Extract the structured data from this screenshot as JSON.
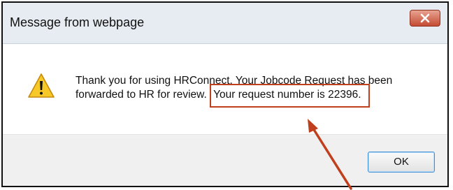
{
  "dialog": {
    "title": "Message from webpage",
    "close_label": "X",
    "message_part1": "Thank you for using HRConnect. Your Jobcode Request has been forwarded to HR for review.",
    "message_highlight": "Your request number is 22396.",
    "ok_label": "OK",
    "icon": "warning-icon"
  },
  "colors": {
    "annotation": "#c0401d",
    "title_bar": "#e7ecf3",
    "close_button": "#c54b33"
  }
}
